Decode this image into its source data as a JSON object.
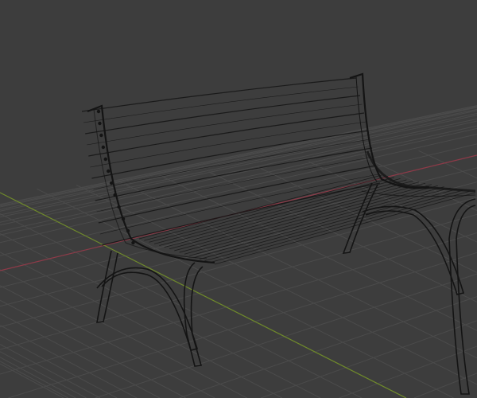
{
  "viewport": {
    "colors": {
      "background": "#3d3d3d",
      "grid": "#4b4b4b",
      "x_axis": "#8e3a48",
      "y_axis": "#6f8a2a",
      "wire": "#141414"
    }
  }
}
